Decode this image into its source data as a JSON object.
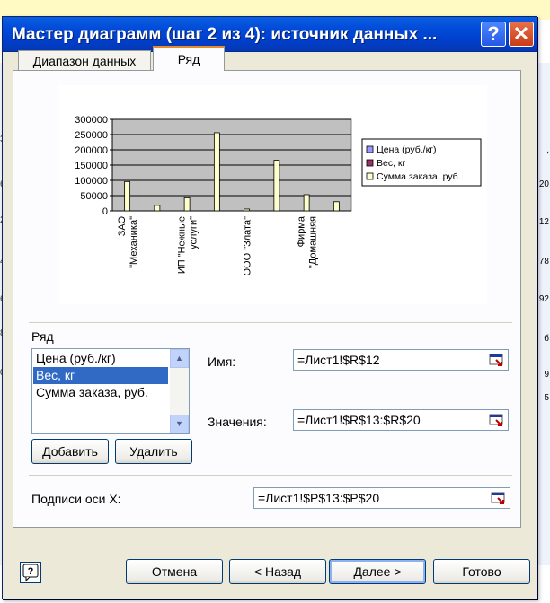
{
  "dialog": {
    "title": "Мастер диаграмм (шаг 2 из 4): источник данных ...",
    "help_glyph": "?",
    "close_glyph": "✕"
  },
  "tabs": [
    {
      "label": "Диапазон данных"
    },
    {
      "label": "Ряд"
    }
  ],
  "chart_data": {
    "type": "bar",
    "categories": [
      "ЗАО \"Механика\"",
      "ИП \"Нежные услуги\"",
      "ООО \"Злата\"",
      "Фирма \"Домашняя\""
    ],
    "category_labels": [
      [
        "ЗАО",
        "\"Механика\""
      ],
      [
        "ИП \"Нежные",
        "услуги\""
      ],
      [
        "ООО \"Злата\""
      ],
      [
        "Фирма",
        "\"Домашняя"
      ]
    ],
    "series": [
      {
        "name": "Цена (руб./кг)",
        "values": [
          0,
          0,
          0,
          0,
          0,
          0,
          0,
          0
        ],
        "color": "#9999ff"
      },
      {
        "name": "Вес, кг",
        "values": [
          0,
          0,
          0,
          0,
          0,
          0,
          0,
          0
        ],
        "color": "#993366"
      },
      {
        "name": "Сумма заказа, руб.",
        "values": [
          96000,
          18000,
          43000,
          256000,
          6000,
          166000,
          53000,
          30000
        ],
        "color": "#ffffcc"
      }
    ],
    "ylim": [
      0,
      300000
    ],
    "yticks": [
      "0",
      "50000",
      "100000",
      "150000",
      "200000",
      "250000",
      "300000"
    ],
    "grid": true,
    "plot_bg": "#c0c0c0",
    "legend_position": "right"
  },
  "series_section": {
    "label": "Ряд",
    "items": [
      "Цена (руб./кг)",
      "Вес, кг",
      "Сумма заказа, руб."
    ],
    "selected_index": 1,
    "add_button": "Добавить",
    "remove_button": "Удалить",
    "name_label": "Имя:",
    "name_value": "=Лист1!$R$12",
    "values_label": "Значения:",
    "values_value": "=Лист1!$R$13:$R$20"
  },
  "x_axis": {
    "label": "Подписи оси X:",
    "value": "=Лист1!$P$13:$P$20"
  },
  "footer": {
    "cancel": "Отмена",
    "back": "< Назад",
    "next": "Далее >",
    "finish": "Готово"
  },
  "background": {
    "left_numbers": [
      "3",
      "б",
      "2",
      "4",
      "б",
      "8",
      "0"
    ],
    "right_numbers": [
      ",",
      "20",
      "12",
      "78",
      "92",
      "б",
      "9",
      "5"
    ]
  }
}
